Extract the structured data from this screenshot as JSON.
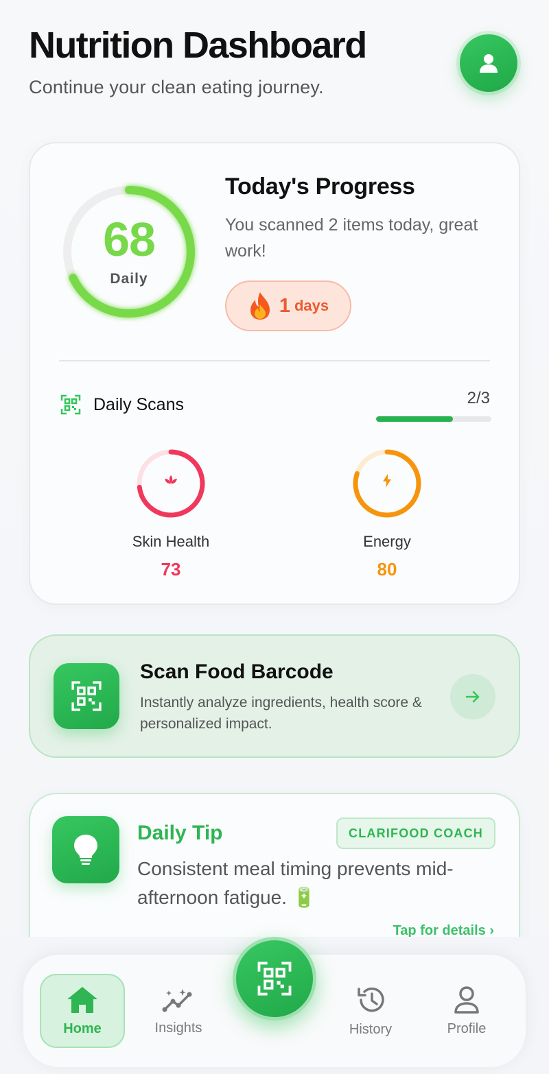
{
  "header": {
    "title": "Nutrition Dashboard",
    "subtitle": "Continue your clean eating journey.",
    "avatar_icon": "user-icon"
  },
  "progress": {
    "score": "68",
    "score_label": "Daily",
    "score_fraction": 0.68,
    "title": "Today's Progress",
    "text": "You scanned 2 items today, great work!",
    "streak_icon": "fire-icon",
    "streak_value": "1",
    "streak_unit": "days",
    "scans_label": "Daily Scans",
    "scans_count": "2/3",
    "scans_fraction": 0.667,
    "metrics": [
      {
        "label": "Skin Health",
        "value": "73",
        "fraction": 0.73,
        "color": "#f0385c",
        "icon": "lotus-icon"
      },
      {
        "label": "Energy",
        "value": "80",
        "fraction": 0.8,
        "color": "#f6950d",
        "icon": "lightning-icon"
      }
    ]
  },
  "scan_card": {
    "title": "Scan Food Barcode",
    "description": "Instantly analyze ingredients, health score & personalized impact.",
    "icon": "qr-scan-icon",
    "arrow_icon": "arrow-right-icon"
  },
  "tip": {
    "title": "Daily Tip",
    "badge": "CLARIFOOD COACH",
    "text": "Consistent meal timing prevents mid-afternoon fatigue. 🔋",
    "link": "Tap for details ›",
    "icon": "lightbulb-icon"
  },
  "nav": {
    "items": [
      {
        "label": "Home",
        "icon": "home-icon",
        "active": true
      },
      {
        "label": "Insights",
        "icon": "insights-icon"
      },
      {
        "label": "History",
        "icon": "history-icon"
      },
      {
        "label": "Profile",
        "icon": "profile-icon"
      }
    ],
    "fab_icon": "qr-scan-icon"
  },
  "colors": {
    "brand": "#34c759",
    "score": "#77d84a",
    "streak": "#ec5b30"
  }
}
